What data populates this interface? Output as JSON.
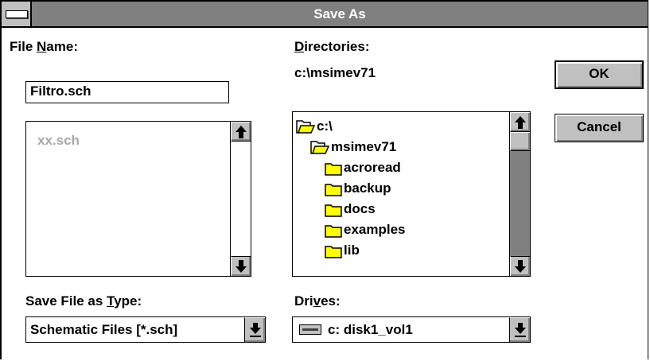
{
  "dialog": {
    "title": "Save As"
  },
  "file_name": {
    "label_before": "File ",
    "label_mnemonic": "N",
    "label_after": "ame:",
    "value": "Filtro.sch",
    "files": [
      "xx.sch"
    ]
  },
  "directories": {
    "label_before": "",
    "label_mnemonic": "D",
    "label_after": "irectories:",
    "current_path": "c:\\msimev71",
    "items": [
      {
        "name": "c:\\",
        "state": "open"
      },
      {
        "name": "msimev71",
        "state": "open"
      },
      {
        "name": "acroread",
        "state": "closed"
      },
      {
        "name": "backup",
        "state": "closed"
      },
      {
        "name": "docs",
        "state": "closed"
      },
      {
        "name": "examples",
        "state": "closed"
      },
      {
        "name": "lib",
        "state": "closed"
      }
    ]
  },
  "save_type": {
    "label_before": "Save File as ",
    "label_mnemonic": "T",
    "label_after": "ype:",
    "value": "Schematic Files [*.sch]"
  },
  "drives": {
    "label_before": "Dri",
    "label_mnemonic": "v",
    "label_after": "es:",
    "value": "c: disk1_vol1"
  },
  "buttons": {
    "ok": "OK",
    "cancel": "Cancel"
  },
  "colors": {
    "titlebar": "#808080",
    "button_face": "#c0c0c0",
    "folder": "#ffff00",
    "disabled_text": "#a8a8a8"
  },
  "icons": {
    "system_menu": "system-menu-icon",
    "scroll_up": "arrow-up-icon",
    "scroll_down": "arrow-down-icon",
    "dropdown": "dropdown-arrow-icon",
    "folder_open": "folder-open-icon",
    "folder_closed": "folder-closed-icon",
    "drive": "hard-drive-icon"
  }
}
